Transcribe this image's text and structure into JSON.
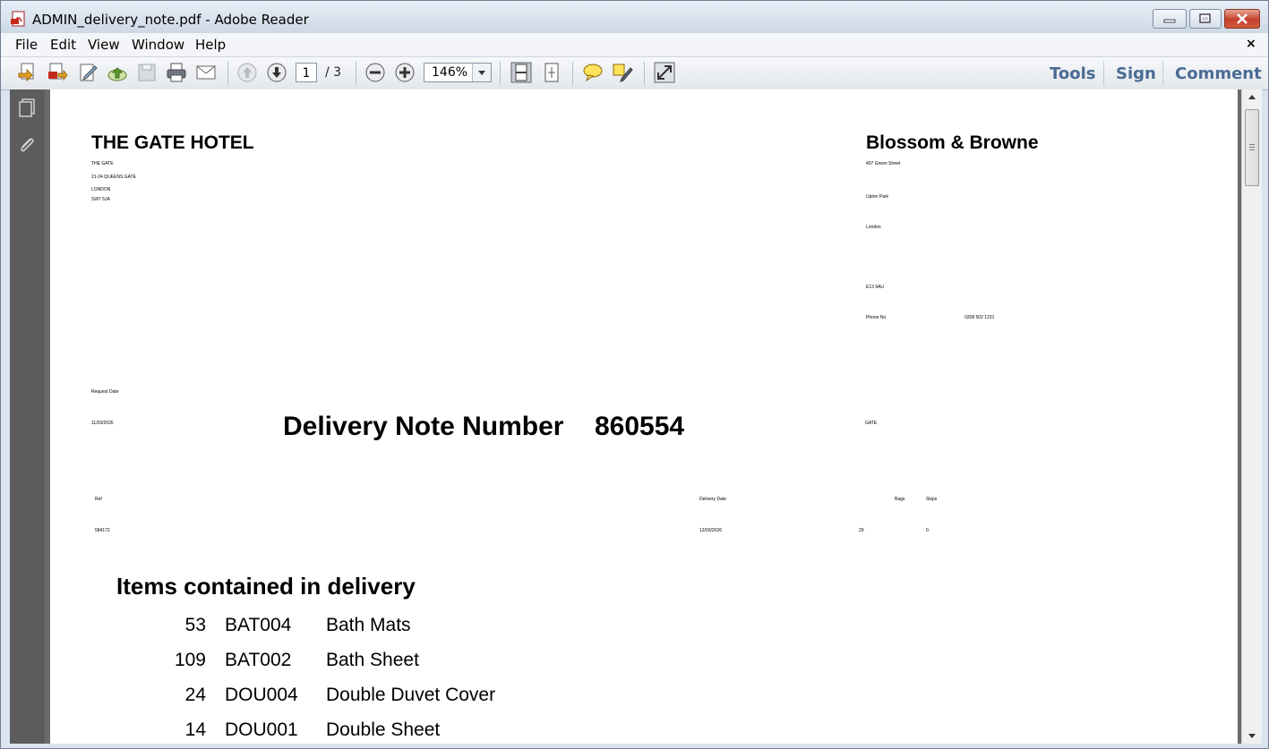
{
  "window": {
    "title": "ADMIN_delivery_note.pdf - Adobe Reader",
    "controls": {
      "minimize": "–",
      "maximize": "□",
      "close": "✕"
    }
  },
  "menu": {
    "items": [
      "File",
      "Edit",
      "View",
      "Window",
      "Help"
    ],
    "close_doc": "×"
  },
  "toolbar": {
    "page_current": "1",
    "page_total": "/ 3",
    "zoom": "146%",
    "tools": "Tools",
    "sign": "Sign",
    "comment": "Comment"
  },
  "document": {
    "sender": {
      "name": "THE GATE HOTEL",
      "lines": [
        "THE GATE",
        "21-24 QUEENS GATE",
        "LONDON",
        "SW7 5JA"
      ]
    },
    "supplier": {
      "name": "Blossom & Browne",
      "street": "407 Green Street",
      "area": "Upton Park",
      "city": "London",
      "postcode": "E13 9AU",
      "phone_label": "Phone No",
      "phone": "0208 502 1231",
      "code": "GATE"
    },
    "request_date_label": "Request Date",
    "request_date": "11/03/2026",
    "delivery_note_label": "Delivery Note Number",
    "delivery_note_number": "860554",
    "info_headers": {
      "ref": "Ref",
      "delivery_date": "Delivery Date",
      "bags": "Bags",
      "skips": "Skips"
    },
    "info_values": {
      "ref": "584172",
      "delivery_date": "12/03/2026",
      "bags": "29",
      "skips": "0"
    },
    "items_heading": "Items contained in delivery",
    "items": [
      {
        "qty": "53",
        "code": "BAT004",
        "desc": "Bath Mats"
      },
      {
        "qty": "109",
        "code": "BAT002",
        "desc": "Bath Sheet"
      },
      {
        "qty": "24",
        "code": "DOU004",
        "desc": "Double Duvet Cover"
      },
      {
        "qty": "14",
        "code": "DOU001",
        "desc": "Double Sheet"
      }
    ]
  }
}
